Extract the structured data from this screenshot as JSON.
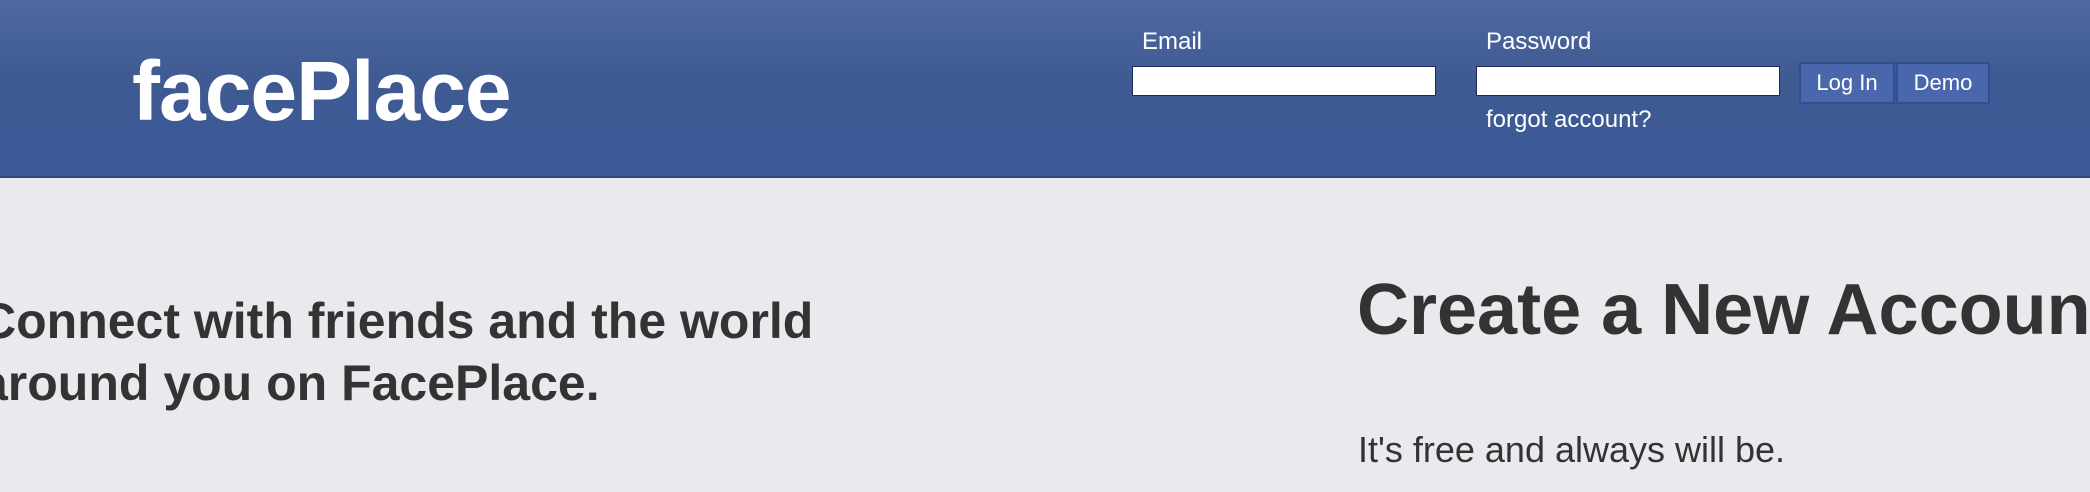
{
  "header": {
    "logo": "facePlace",
    "email_label": "Email",
    "email_value": "",
    "password_label": "Password",
    "password_value": "",
    "forgot_link": "forgot account?",
    "login_button": "Log In",
    "demo_button": "Demo"
  },
  "main": {
    "tagline": "Connect with friends and the world around you on FacePlace.",
    "signup_title": "Create a New Account",
    "signup_subtitle": "It's free and always will be."
  },
  "colors": {
    "header_background": "#3b5998",
    "page_background": "#e9eaed",
    "button_background": "#4a67ad",
    "text": "#333333"
  }
}
